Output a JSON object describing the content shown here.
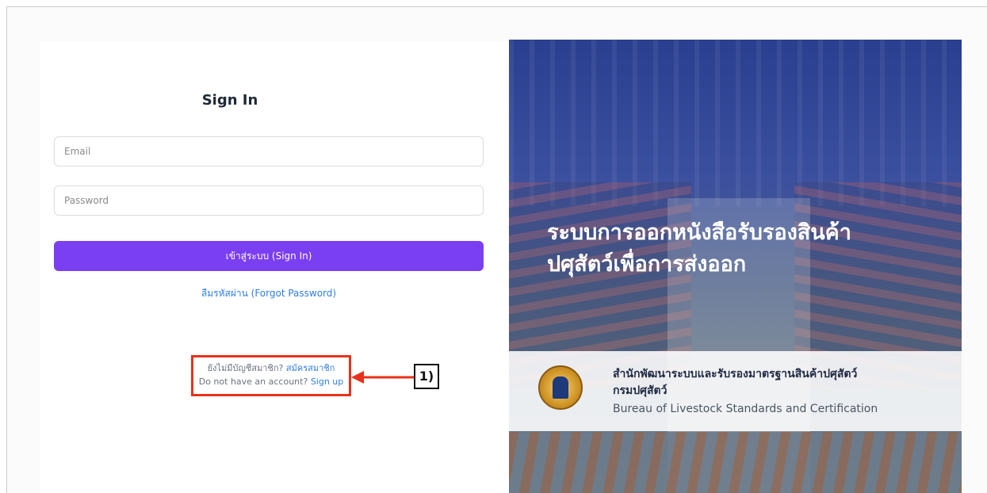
{
  "signin": {
    "title": "Sign In",
    "email_placeholder": "Email",
    "password_placeholder": "Password",
    "submit_label": "เข้าสู่ระบบ (Sign In)",
    "forgot_label": "ลืมรหัสผ่าน (Forgot Password)"
  },
  "signup": {
    "th_prompt": "ยังไม่มีบัญชีสมาชิก?",
    "th_link": "สมัครสมาชิก",
    "en_prompt": "Do not have an account?",
    "en_link": "Sign up"
  },
  "annotation": {
    "callout_label": "1)",
    "highlight_color": "#e8311a"
  },
  "hero": {
    "title_line1": "ระบบการออกหนังสือรับรองสินค้า",
    "title_line2": "ปศุสัตว์เพื่อการส่งออก"
  },
  "bureau": {
    "name_th_line1": "สำนักพัฒนาระบบและรับรองมาตรฐานสินค้าปศุสัตว์",
    "name_th_line2": "กรมปศุสัตว์",
    "name_en": "Bureau of Livestock Standards and Certification"
  },
  "colors": {
    "primary_button": "#7b3ff2",
    "link": "#2f7ee0"
  }
}
